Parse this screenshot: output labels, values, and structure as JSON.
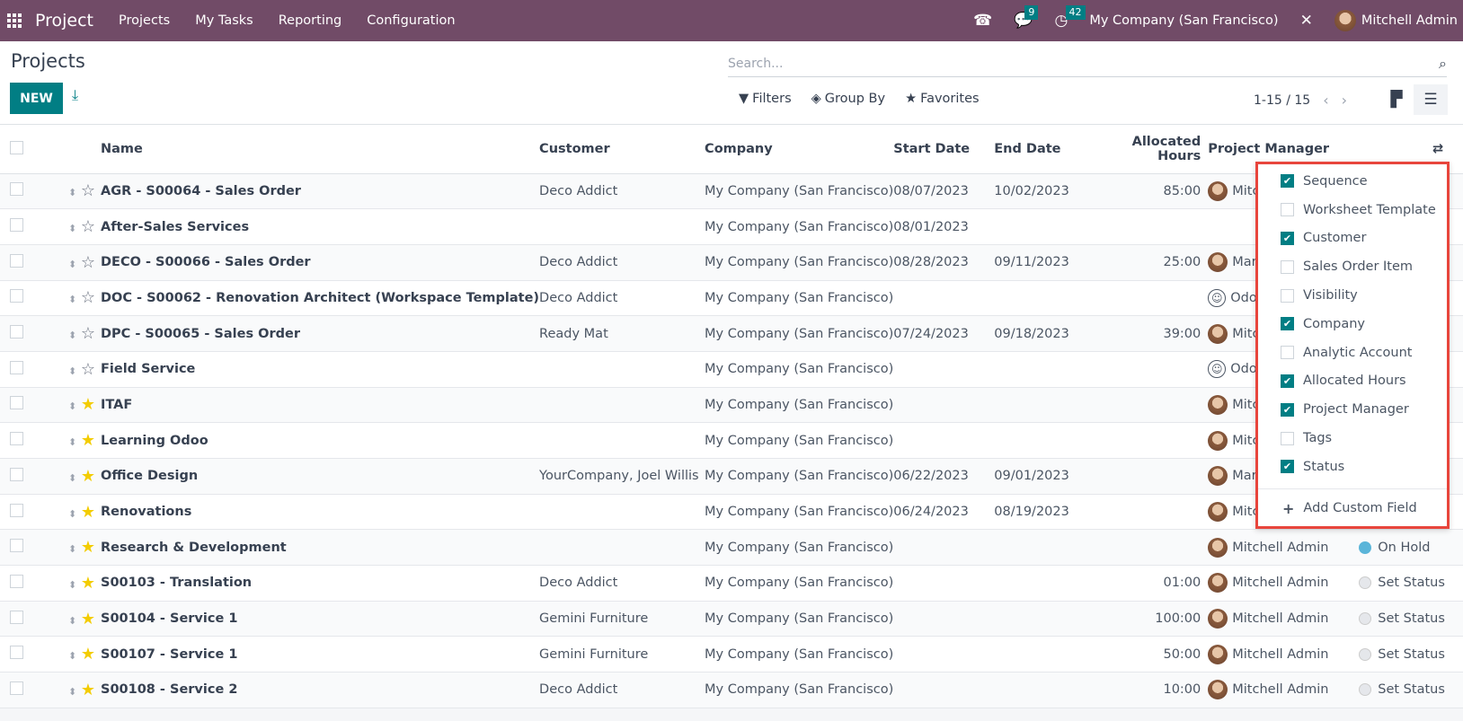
{
  "topbar": {
    "app_name": "Project",
    "menu": [
      "Projects",
      "My Tasks",
      "Reporting",
      "Configuration"
    ],
    "messages_count": "9",
    "activities_count": "42",
    "company": "My Company (San Francisco)",
    "user": "Mitchell Admin"
  },
  "control": {
    "title": "Projects",
    "new_label": "NEW",
    "search_placeholder": "Search...",
    "filters_label": "Filters",
    "groupby_label": "Group By",
    "favorites_label": "Favorites",
    "pager": "1-15 / 15"
  },
  "table": {
    "headers": {
      "name": "Name",
      "customer": "Customer",
      "company": "Company",
      "start": "Start Date",
      "end": "End Date",
      "hours": "Allocated Hours",
      "manager": "Project Manager"
    },
    "rows": [
      {
        "name": "AGR - S00064 - Sales Order",
        "fav": false,
        "customer": "Deco Addict",
        "company": "My Company (San Francisco)",
        "start": "08/07/2023",
        "end": "10/02/2023",
        "hours": "85:00",
        "manager": "Mitchell Admin",
        "avatar": "photo",
        "status": ""
      },
      {
        "name": "After-Sales Services",
        "fav": false,
        "customer": "",
        "company": "My Company (San Francisco)",
        "start": "08/01/2023",
        "end": "",
        "hours": "",
        "manager": "",
        "avatar": "",
        "status": ""
      },
      {
        "name": "DECO - S00066 - Sales Order",
        "fav": false,
        "customer": "Deco Addict",
        "company": "My Company (San Francisco)",
        "start": "08/28/2023",
        "end": "09/11/2023",
        "hours": "25:00",
        "manager": "Marc Demo",
        "avatar": "photo",
        "status": ""
      },
      {
        "name": "DOC - S00062 - Renovation Architect (Workspace Template)",
        "fav": false,
        "customer": "Deco Addict",
        "company": "My Company (San Francisco)",
        "start": "",
        "end": "",
        "hours": "",
        "manager": "OdooBot",
        "avatar": "smiley",
        "status": ""
      },
      {
        "name": "DPC - S00065 - Sales Order",
        "fav": false,
        "customer": "Ready Mat",
        "company": "My Company (San Francisco)",
        "start": "07/24/2023",
        "end": "09/18/2023",
        "hours": "39:00",
        "manager": "Mitchell Admin",
        "avatar": "photo",
        "status": ""
      },
      {
        "name": "Field Service",
        "fav": false,
        "customer": "",
        "company": "My Company (San Francisco)",
        "start": "",
        "end": "",
        "hours": "",
        "manager": "OdooBot",
        "avatar": "smiley",
        "status": ""
      },
      {
        "name": "ITAF",
        "fav": true,
        "customer": "",
        "company": "My Company (San Francisco)",
        "start": "",
        "end": "",
        "hours": "",
        "manager": "Mitchell Admin",
        "avatar": "photo",
        "status": ""
      },
      {
        "name": "Learning Odoo",
        "fav": true,
        "customer": "",
        "company": "My Company (San Francisco)",
        "start": "",
        "end": "",
        "hours": "",
        "manager": "Mitchell Admin",
        "avatar": "photo",
        "status": ""
      },
      {
        "name": "Office Design",
        "fav": true,
        "customer": "YourCompany, Joel Willis",
        "company": "My Company (San Francisco)",
        "start": "06/22/2023",
        "end": "09/01/2023",
        "hours": "",
        "manager": "Marc Demo",
        "avatar": "photo",
        "status": ""
      },
      {
        "name": "Renovations",
        "fav": true,
        "customer": "",
        "company": "My Company (San Francisco)",
        "start": "06/24/2023",
        "end": "08/19/2023",
        "hours": "",
        "manager": "Mitchell Admin",
        "avatar": "photo",
        "status": ""
      },
      {
        "name": "Research & Development",
        "fav": true,
        "customer": "",
        "company": "My Company (San Francisco)",
        "start": "",
        "end": "",
        "hours": "",
        "manager": "Mitchell Admin",
        "avatar": "photo",
        "status": "On Hold"
      },
      {
        "name": "S00103 - Translation",
        "fav": true,
        "customer": "Deco Addict",
        "company": "My Company (San Francisco)",
        "start": "",
        "end": "",
        "hours": "01:00",
        "manager": "Mitchell Admin",
        "avatar": "photo",
        "status": "Set Status"
      },
      {
        "name": "S00104 - Service 1",
        "fav": true,
        "customer": "Gemini Furniture",
        "company": "My Company (San Francisco)",
        "start": "",
        "end": "",
        "hours": "100:00",
        "manager": "Mitchell Admin",
        "avatar": "photo",
        "status": "Set Status"
      },
      {
        "name": "S00107 - Service 1",
        "fav": true,
        "customer": "Gemini Furniture",
        "company": "My Company (San Francisco)",
        "start": "",
        "end": "",
        "hours": "50:00",
        "manager": "Mitchell Admin",
        "avatar": "photo",
        "status": "Set Status"
      },
      {
        "name": "S00108 - Service 2",
        "fav": true,
        "customer": "Deco Addict",
        "company": "My Company (San Francisco)",
        "start": "",
        "end": "",
        "hours": "10:00",
        "manager": "Mitchell Admin",
        "avatar": "photo",
        "status": "Set Status"
      }
    ]
  },
  "column_picker": {
    "options": [
      {
        "label": "Sequence",
        "checked": true
      },
      {
        "label": "Worksheet Template",
        "checked": false
      },
      {
        "label": "Customer",
        "checked": true
      },
      {
        "label": "Sales Order Item",
        "checked": false
      },
      {
        "label": "Visibility",
        "checked": false
      },
      {
        "label": "Company",
        "checked": true
      },
      {
        "label": "Analytic Account",
        "checked": false
      },
      {
        "label": "Allocated Hours",
        "checked": true
      },
      {
        "label": "Project Manager",
        "checked": true
      },
      {
        "label": "Tags",
        "checked": false
      },
      {
        "label": "Status",
        "checked": true
      }
    ],
    "add_custom_label": "Add Custom Field"
  },
  "colors": {
    "brand": "#714b67",
    "accent": "#017e84",
    "favorite": "#f3cc00",
    "highlight_border": "#e8453c",
    "on_hold": "#5bb5d9"
  }
}
